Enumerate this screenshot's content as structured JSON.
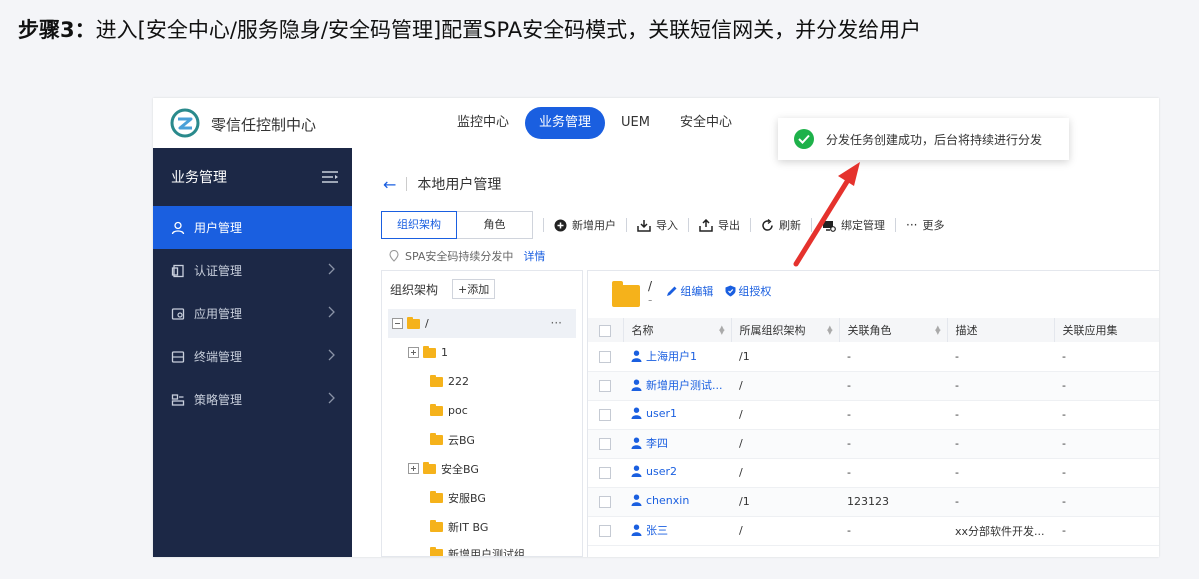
{
  "slide": {
    "step_label": "步骤3：",
    "description": "进入[安全中心/服务隐身/安全码管理]配置SPA安全码模式，关联短信网关，并分发给用户"
  },
  "app": {
    "name": "零信任控制中心"
  },
  "nav": [
    {
      "label": "监控中心"
    },
    {
      "label": "业务管理"
    },
    {
      "label": "UEM"
    },
    {
      "label": "安全中心"
    }
  ],
  "sidebar": {
    "title": "业务管理",
    "items": [
      {
        "label": "用户管理",
        "icon": "user-icon"
      },
      {
        "label": "认证管理",
        "icon": "auth-icon"
      },
      {
        "label": "应用管理",
        "icon": "app-icon"
      },
      {
        "label": "终端管理",
        "icon": "terminal-icon"
      },
      {
        "label": "策略管理",
        "icon": "policy-icon"
      }
    ]
  },
  "page": {
    "title": "本地用户管理"
  },
  "toolbar": {
    "tab_org": "组织架构",
    "tab_role": "角色",
    "add_user": "新增用户",
    "import": "导入",
    "export": "导出",
    "refresh": "刷新",
    "bind": "绑定管理",
    "more": "更多"
  },
  "notice": {
    "text": "SPA安全码持续分发中",
    "detail": "详情"
  },
  "tree": {
    "title": "组织架构",
    "add_label": "+添加",
    "root": "/",
    "more": "···",
    "nodes": [
      "1",
      "222",
      "poc",
      "云BG",
      "安全BG",
      "安服BG",
      "新IT BG",
      "新增用户测试组"
    ]
  },
  "group": {
    "path": "/",
    "path_sub": "-",
    "edit": "组编辑",
    "auth": "组授权"
  },
  "table": {
    "columns": [
      "名称",
      "所属组织架构",
      "关联角色",
      "描述",
      "关联应用集"
    ],
    "rows": [
      {
        "name": "上海用户1",
        "org": "/1",
        "role": "-",
        "desc": "-",
        "apps": "-"
      },
      {
        "name": "新增用户测试...",
        "org": "/",
        "role": "-",
        "desc": "-",
        "apps": "-"
      },
      {
        "name": "user1",
        "org": "/",
        "role": "-",
        "desc": "-",
        "apps": "-"
      },
      {
        "name": "李四",
        "org": "/",
        "role": "-",
        "desc": "-",
        "apps": "-"
      },
      {
        "name": "user2",
        "org": "/",
        "role": "-",
        "desc": "-",
        "apps": "-"
      },
      {
        "name": "chenxin",
        "org": "/1",
        "role": "123123",
        "desc": "-",
        "apps": "-"
      },
      {
        "name": "张三",
        "org": "/",
        "role": "-",
        "desc": "xx分部软件开发...",
        "apps": "-"
      }
    ]
  },
  "toast": {
    "message": "分发任务创建成功，后台将持续进行分发"
  },
  "colors": {
    "primary": "#1a5fe0",
    "sidebar_bg": "#1c2846",
    "success": "#1eb14a",
    "arrow": "#e5322d",
    "folder": "#f5b21b"
  }
}
